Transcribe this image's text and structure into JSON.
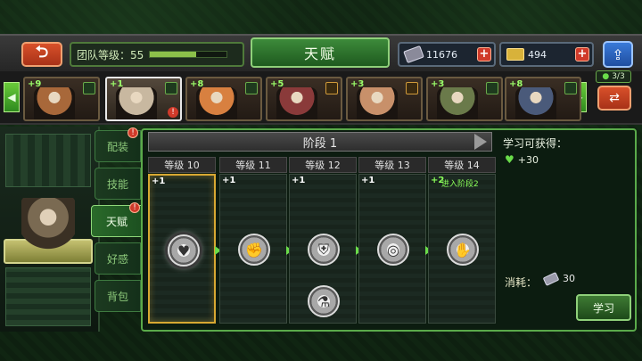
{
  "header": {
    "back_icon": "back-arrow-icon",
    "team_level_label": "团队等级：55",
    "team_level_progress": 0.6,
    "title": "天赋",
    "currencies": [
      {
        "name": "ticket",
        "value": "11676",
        "color": "#8a8a9a"
      },
      {
        "name": "gold",
        "value": "494",
        "color": "#d8b23a"
      }
    ],
    "share_icon": "share-icon"
  },
  "hero_strip": {
    "count": "3/3",
    "heroes": [
      {
        "plus": "+9",
        "type": "soldier",
        "color": "#a8683a"
      },
      {
        "plus": "+1",
        "type": "soldier",
        "color": "#c8b8a0",
        "selected": true,
        "badge": "!"
      },
      {
        "plus": "+8",
        "type": "soldier",
        "color": "#d88040"
      },
      {
        "plus": "+5",
        "type": "support",
        "color": "#8a3a3a"
      },
      {
        "plus": "+3",
        "type": "support",
        "color": "#c8906a"
      },
      {
        "plus": "+3",
        "type": "soldier",
        "color": "#6a7a4a"
      },
      {
        "plus": "+8",
        "type": "soldier",
        "color": "#4a5a7a"
      }
    ]
  },
  "side_tabs": [
    {
      "label": "配装",
      "badge": "!"
    },
    {
      "label": "技能"
    },
    {
      "label": "天赋",
      "active": true,
      "badge": "!"
    },
    {
      "label": "好感"
    },
    {
      "label": "背包"
    }
  ],
  "stage": {
    "title": "阶段 1",
    "columns": [
      {
        "label": "等级 10",
        "tag": "+1",
        "selected": true,
        "icons": [
          "heart-icon"
        ]
      },
      {
        "label": "等级 11",
        "tag": "+1",
        "icons": [
          "fist-icon"
        ]
      },
      {
        "label": "等级 12",
        "tag": "+1",
        "icons": [
          "shield-icon",
          "flask-icon"
        ]
      },
      {
        "label": "等级 13",
        "tag": "+1",
        "icons": [
          "target-icon"
        ]
      },
      {
        "label": "等级 14",
        "tag": "+2",
        "note": "进入阶段2",
        "icons": [
          "hand-icon"
        ]
      }
    ]
  },
  "info": {
    "title": "学习可获得：",
    "reward": "+30",
    "cost_label": "消耗：",
    "cost_value": "30",
    "learn_label": "学习"
  }
}
